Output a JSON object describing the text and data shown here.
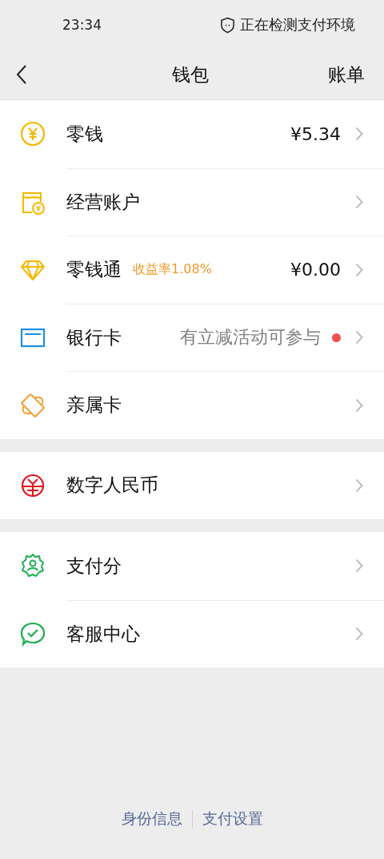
{
  "status_bar": {
    "time": "23:34",
    "security_text": "正在检测支付环境"
  },
  "nav": {
    "title": "钱包",
    "action": "账单"
  },
  "sections": [
    {
      "items": [
        {
          "label": "零钱",
          "value": "¥5.34",
          "notice_dot": false
        },
        {
          "label": "经营账户",
          "notice_dot": false
        },
        {
          "label": "零钱通",
          "tag": "收益率1.08%",
          "value": "¥0.00",
          "notice_dot": false
        },
        {
          "label": "银行卡",
          "hint": "有立减活动可参与",
          "notice_dot": true
        },
        {
          "label": "亲属卡",
          "notice_dot": false
        }
      ]
    },
    {
      "items": [
        {
          "label": "数字人民币",
          "notice_dot": false
        }
      ]
    },
    {
      "items": [
        {
          "label": "支付分",
          "notice_dot": false
        },
        {
          "label": "客服中心",
          "notice_dot": false
        }
      ]
    }
  ],
  "footer_links": [
    "身份信息",
    "支付设置"
  ]
}
